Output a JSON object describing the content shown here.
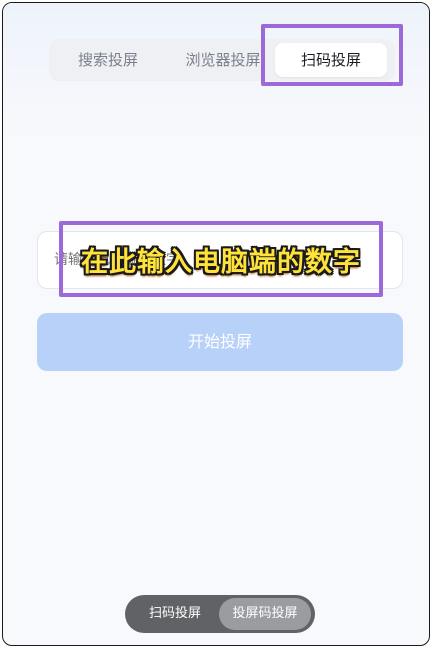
{
  "tabs": [
    {
      "label": "搜索投屏",
      "active": false
    },
    {
      "label": "浏览器投屏",
      "active": false
    },
    {
      "label": "扫码投屏",
      "active": true
    }
  ],
  "input": {
    "placeholder": "请输入电脑端的数字"
  },
  "annotation": {
    "text": "在此输入电脑端的数字",
    "text_color": "#ffe23a",
    "box_color": "#9b6ad8"
  },
  "start_button": {
    "label": "开始投屏",
    "color": "#b8d1f8"
  },
  "mode_toggle": {
    "items": [
      {
        "label": "扫码投屏",
        "active": false
      },
      {
        "label": "投屏码投屏",
        "active": true
      }
    ]
  }
}
